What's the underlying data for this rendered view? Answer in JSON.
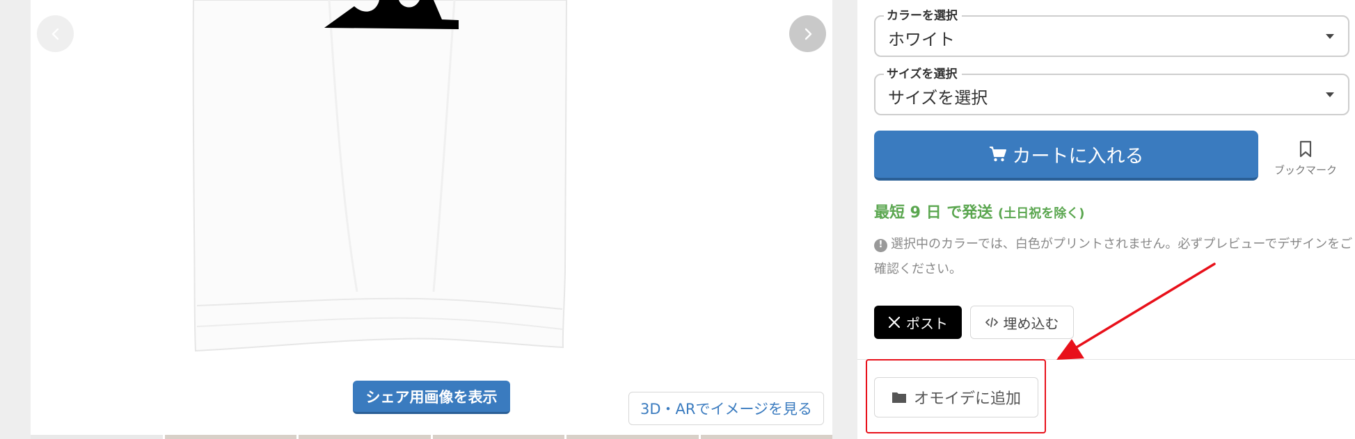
{
  "gallery": {
    "share_image_label": "シェア用画像を表示",
    "ar_view_label": "3D・ARでイメージを見る",
    "thumbnails": [
      1,
      2,
      3,
      4,
      5,
      6
    ]
  },
  "product_options": {
    "color": {
      "label": "カラーを選択",
      "value": "ホワイト"
    },
    "size": {
      "label": "サイズを選択",
      "value": "サイズを選択"
    }
  },
  "actions": {
    "add_to_cart_label": "カートに入れる",
    "bookmark_label": "ブックマーク"
  },
  "shipping": {
    "text": "最短 9 日 で発送",
    "note": "(土日祝を除く)"
  },
  "print_notice": "選択中のカラーでは、白色がプリントされません。必ずプレビューでデザインをご確認ください。",
  "share": {
    "post_label": "ポスト",
    "embed_label": "埋め込む"
  },
  "omoide": {
    "add_label": "オモイデに追加"
  },
  "colors": {
    "primary": "#3a7bbf",
    "shipping_green": "#5aa64f",
    "annotation_red": "#e8101a"
  }
}
